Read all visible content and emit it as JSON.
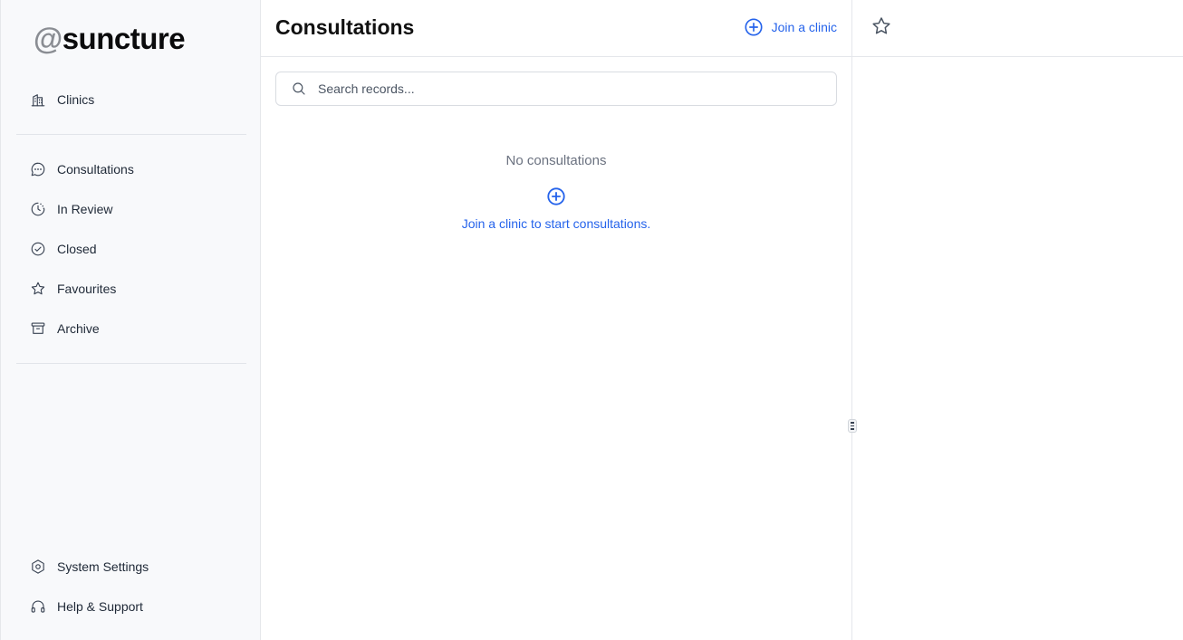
{
  "logo": {
    "at": "@",
    "name": "suncture"
  },
  "sidebar": {
    "top_items": [
      {
        "label": "Clinics",
        "icon": "building-icon"
      }
    ],
    "main_items": [
      {
        "label": "Consultations",
        "icon": "chat-icon"
      },
      {
        "label": "In Review",
        "icon": "clock-icon"
      },
      {
        "label": "Closed",
        "icon": "check-circle-icon"
      },
      {
        "label": "Favourites",
        "icon": "star-icon"
      },
      {
        "label": "Archive",
        "icon": "archive-icon"
      }
    ],
    "bottom_items": [
      {
        "label": "System Settings",
        "icon": "gear-icon"
      },
      {
        "label": "Help & Support",
        "icon": "headset-icon"
      }
    ]
  },
  "main": {
    "title": "Consultations",
    "join_label": "Join a clinic",
    "search": {
      "placeholder": "Search records..."
    },
    "empty": {
      "title": "No consultations",
      "link": "Join a clinic to start consultations."
    }
  },
  "colors": {
    "accent": "#2563eb",
    "sidebar_bg": "#f8f9fb",
    "border": "#e5e7eb"
  }
}
